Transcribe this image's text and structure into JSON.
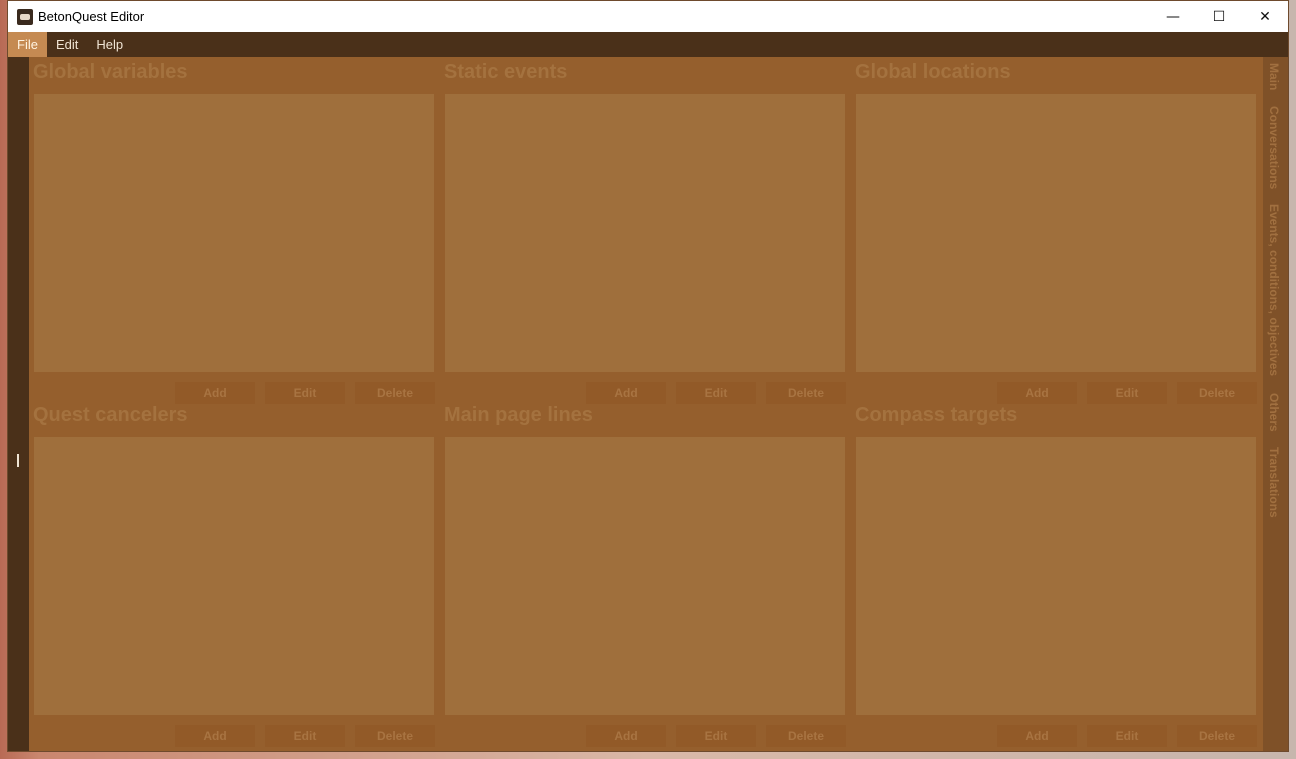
{
  "window": {
    "title": "BetonQuest Editor"
  },
  "window_controls": {
    "minimize": "—",
    "maximize": "☐",
    "close": "✕"
  },
  "menu": [
    {
      "label": "File"
    },
    {
      "label": "Edit"
    },
    {
      "label": "Help"
    }
  ],
  "panels": [
    {
      "title": "Global variables"
    },
    {
      "title": "Static events"
    },
    {
      "title": "Global locations"
    },
    {
      "title": "Quest cancelers"
    },
    {
      "title": "Main page lines"
    },
    {
      "title": "Compass targets"
    }
  ],
  "buttons": {
    "add": "Add",
    "edit": "Edit",
    "delete": "Delete"
  },
  "tabs": [
    {
      "label": "Main"
    },
    {
      "label": "Conversations"
    },
    {
      "label": "Events, conditions, objectives"
    },
    {
      "label": "Others"
    },
    {
      "label": "Translations"
    }
  ],
  "colors": {
    "menu_bg": "#4a3019",
    "menu_active": "#c58a52",
    "content_bg": "#955f2d",
    "list_bg": "#9f6f3c",
    "tab_strip": "#7f5128"
  }
}
